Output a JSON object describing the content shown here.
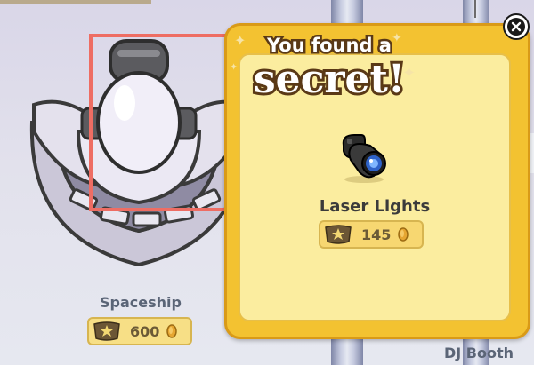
{
  "scene": {
    "items": [
      {
        "name": "Spaceship",
        "price": "600"
      },
      {
        "name": "DJ Booth"
      }
    ]
  },
  "popup": {
    "title_line1": "You found a",
    "title_line2": "secret!",
    "item_name": "Laser Lights",
    "item_price": "145",
    "close_icon": "close-x-icon",
    "item_icon": "laser-lights-icon"
  },
  "colors": {
    "popup_gold": "#f3c231",
    "popup_inner": "#fbed9f",
    "highlight": "#ee6d63",
    "caption": "#5b6577"
  }
}
